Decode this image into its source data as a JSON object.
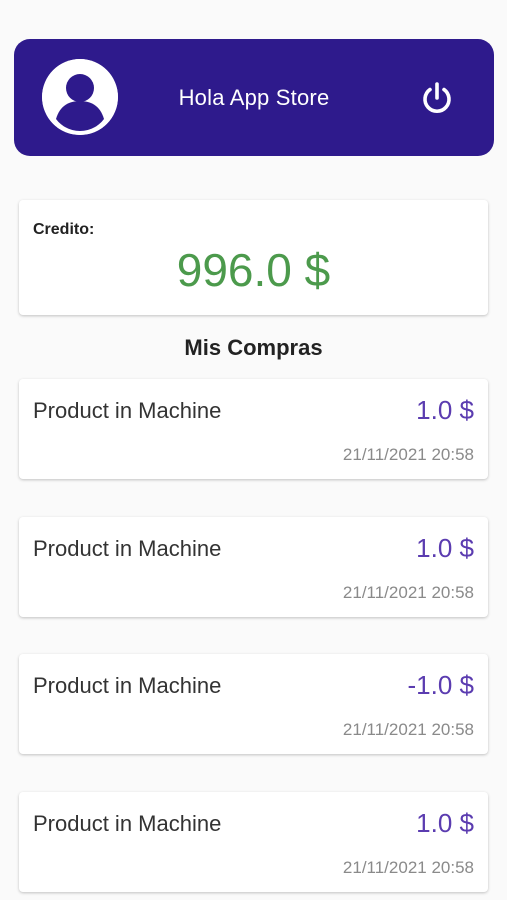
{
  "header": {
    "greeting": "Hola App Store",
    "avatar_icon": "account-circle-icon",
    "power_icon": "power-icon",
    "background_color": "#2e1a8c"
  },
  "credit": {
    "label": "Credito:",
    "value": "996.0 $",
    "value_color": "#4c9a4c"
  },
  "purchases": {
    "title": "Mis Compras",
    "items": [
      {
        "name": "Product in Machine",
        "amount": "1.0 $",
        "date": "21/11/2021 20:58"
      },
      {
        "name": "Product in Machine",
        "amount": "1.0 $",
        "date": "21/11/2021 20:58"
      },
      {
        "name": "Product in Machine",
        "amount": "-1.0 $",
        "date": "21/11/2021 20:58"
      },
      {
        "name": "Product in Machine",
        "amount": "1.0 $",
        "date": "21/11/2021 20:58"
      }
    ],
    "amount_color": "#5b3cb0"
  }
}
